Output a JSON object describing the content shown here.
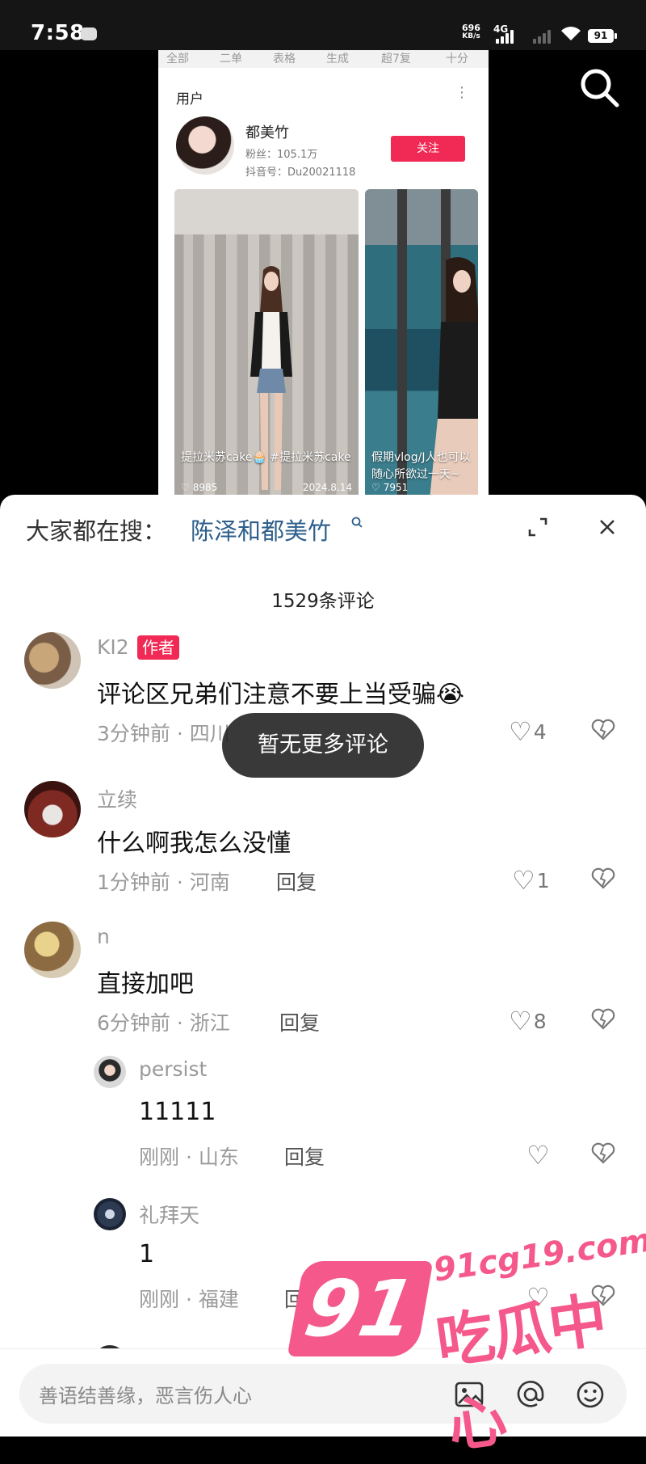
{
  "status_bar": {
    "time": "7:58",
    "speed_top": "696",
    "speed_unit": "KB/s",
    "network": "4G",
    "battery": "91"
  },
  "shared_card": {
    "tabs": [
      "全部",
      "二单",
      "表格",
      "生成",
      "超7复",
      "十分"
    ],
    "section_title": "用户",
    "user": {
      "name": "都美竹",
      "fans": "粉丝：105.1万",
      "id": "抖音号：Du20021118",
      "follow_label": "关注"
    },
    "videos": [
      {
        "caption": "提拉米苏cake🧁 #提拉米苏cake",
        "likes": "8985",
        "date": "2024.8.14"
      },
      {
        "caption": "假期vlog/J人也可以随心所欲过一天~",
        "likes": "7951",
        "date": ""
      }
    ]
  },
  "comments_panel": {
    "trending_label": "大家都在搜：",
    "trending_query": "陈泽和都美竹",
    "count_label": "1529条评论",
    "toast": "暂无更多评论",
    "comments": [
      {
        "name": "KI2",
        "badge": "作者",
        "text": "评论区兄弟们注意不要上当受骗😭",
        "meta": "3分钟前 · 四川",
        "reply": "回复",
        "likes": "4"
      },
      {
        "name": "立续",
        "text": "什么啊我怎么没懂",
        "meta": "1分钟前 · 河南",
        "reply": "回复",
        "likes": "1"
      },
      {
        "name": "n",
        "text": "直接加吧",
        "meta": "6分钟前 · 浙江",
        "reply": "回复",
        "likes": "8"
      }
    ],
    "replies": [
      {
        "name": "persist",
        "text": "11111",
        "meta": "刚刚 · 山东",
        "reply": "回复",
        "likes": ""
      },
      {
        "name": "礼拜天",
        "text": "1",
        "meta": "刚刚 · 福建",
        "reply": "回复",
        "likes": ""
      }
    ]
  },
  "input": {
    "placeholder": "善语结善缘，恶言伤人心"
  },
  "watermark": {
    "number": "91",
    "url": "91cg19.com",
    "text": "吃瓜中心"
  },
  "colors": {
    "accent": "#f02a54",
    "link": "#2e5f8c",
    "watermark": "#f5588b"
  }
}
